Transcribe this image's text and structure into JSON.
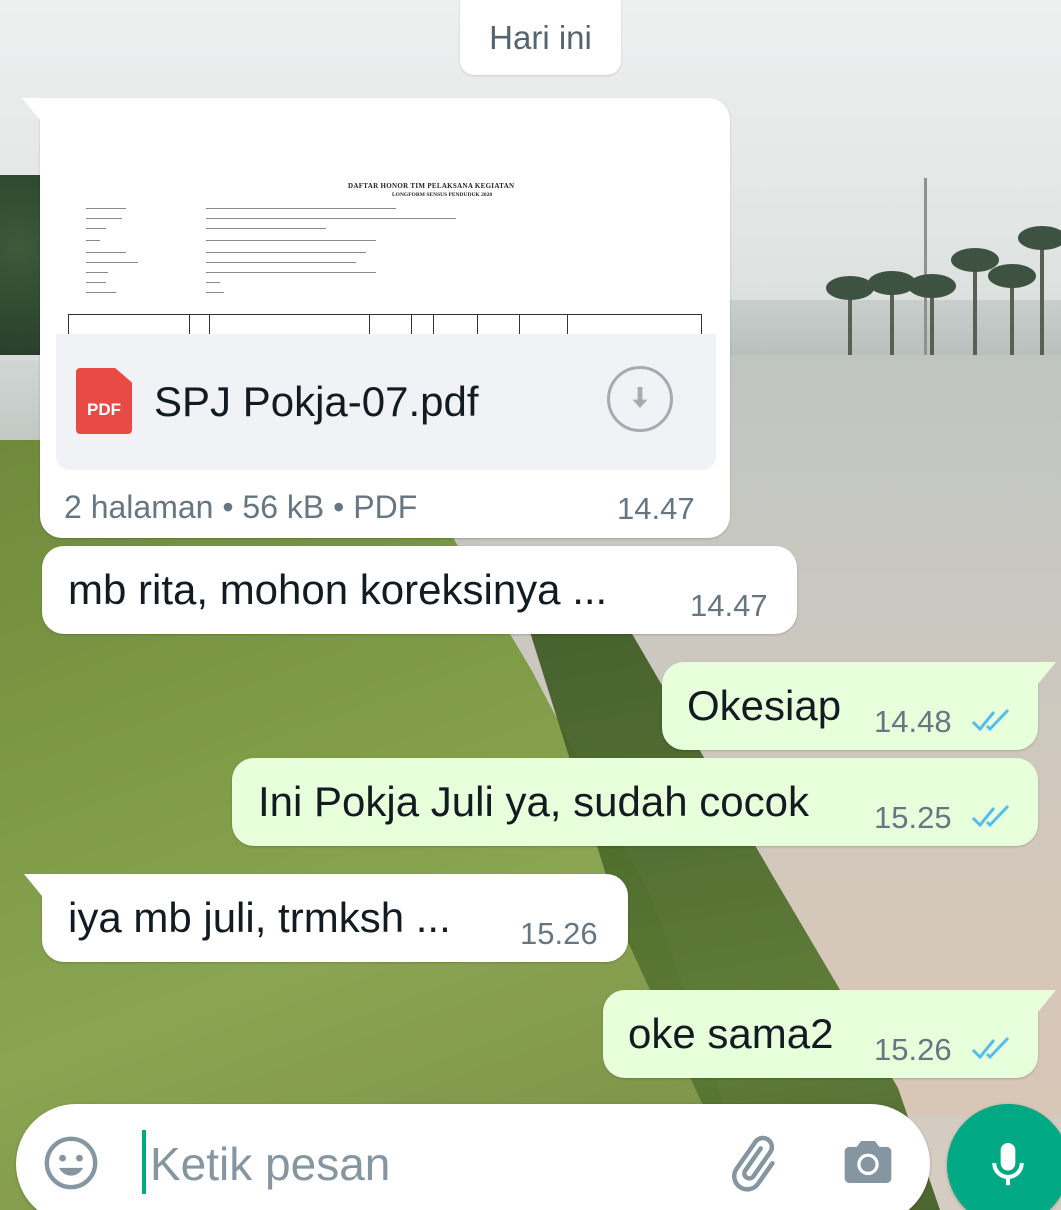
{
  "date_chip": "Hari ini",
  "messages": [
    {
      "type": "document",
      "direction": "incoming",
      "preview": {
        "title": "DAFTAR HONOR TIM PELAKSANA KEGIATAN",
        "subtitle": "LONGFORM SENSUS PENDUDUK 2020"
      },
      "file_name": "SPJ Pokja-07.pdf",
      "file_type_badge": "PDF",
      "meta": "2 halaman • 56 kB • PDF",
      "time": "14.47"
    },
    {
      "type": "text",
      "direction": "incoming",
      "text": "mb rita, mohon koreksinya ...",
      "time": "14.47"
    },
    {
      "type": "text",
      "direction": "outgoing",
      "text": "Okesiap",
      "time": "14.48",
      "status": "read"
    },
    {
      "type": "text",
      "direction": "outgoing",
      "text": "Ini Pokja Juli ya, sudah cocok",
      "time": "15.25",
      "status": "read"
    },
    {
      "type": "text",
      "direction": "incoming",
      "text": "iya mb juli, trmksh ...",
      "time": "15.26"
    },
    {
      "type": "text",
      "direction": "outgoing",
      "text": "oke sama2",
      "time": "15.26",
      "status": "read"
    }
  ],
  "composer": {
    "placeholder": "Ketik pesan",
    "value": "",
    "icons": [
      "emoji-icon",
      "attach-icon",
      "camera-icon",
      "mic-icon"
    ]
  },
  "colors": {
    "incoming_bubble": "#ffffff",
    "outgoing_bubble": "#e7ffdb",
    "read_ticks": "#53bdeb",
    "accent": "#00a884",
    "pdf_badge": "#e84b46"
  }
}
